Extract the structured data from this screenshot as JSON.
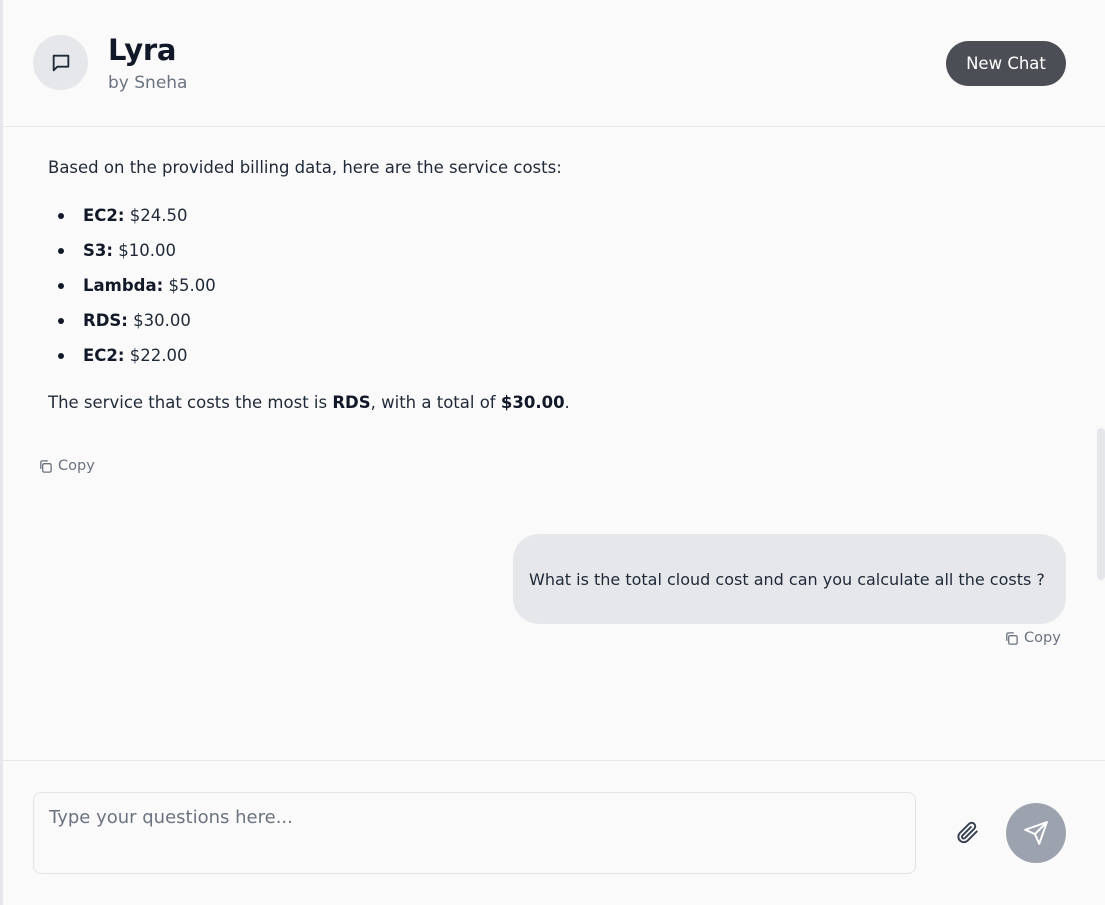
{
  "header": {
    "title": "Lyra",
    "subtitle": "by Sneha",
    "avatar_icon": "chat-bubble-icon",
    "new_chat_label": "New Chat"
  },
  "messages": {
    "bot": {
      "intro": "Based on the provided billing data, here are the service costs:",
      "items": [
        {
          "service": "EC2:",
          "cost": "$24.50"
        },
        {
          "service": "S3:",
          "cost": "$10.00"
        },
        {
          "service": "Lambda:",
          "cost": "$5.00"
        },
        {
          "service": "RDS:",
          "cost": "$30.00"
        },
        {
          "service": "EC2:",
          "cost": "$22.00"
        }
      ],
      "summary_prefix": "The service that costs the most is ",
      "summary_service": "RDS",
      "summary_middle": ", with a total of ",
      "summary_total": "$30.00",
      "summary_suffix": ".",
      "copy_label": "Copy"
    },
    "user": {
      "text": "What is the total cloud cost and can you calculate all the costs ?",
      "copy_label": "Copy"
    }
  },
  "composer": {
    "placeholder": "Type your questions here...",
    "attach_icon": "paperclip-icon",
    "send_icon": "send-icon"
  },
  "colors": {
    "background": "#fafafa",
    "new_chat_bg": "#4b4f55",
    "user_bubble": "#e5e7eb",
    "send_button": "#9ca3af"
  }
}
